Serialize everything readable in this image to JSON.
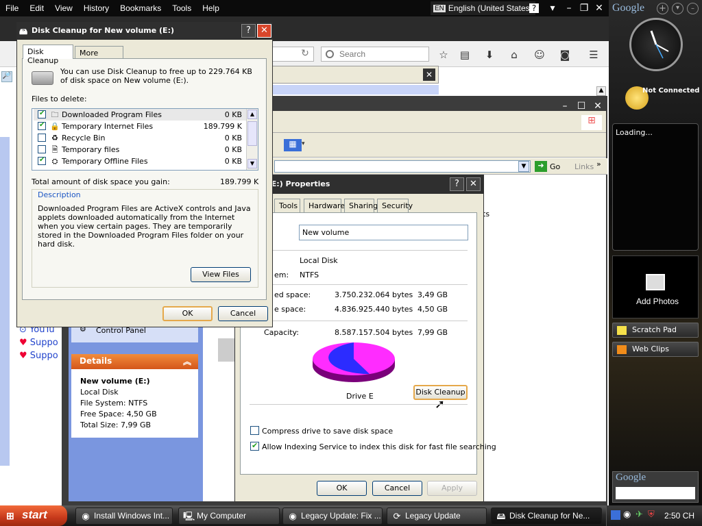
{
  "firefox": {
    "menu": [
      "File",
      "Edit",
      "View",
      "History",
      "Bookmarks",
      "Tools",
      "Help"
    ],
    "language": "English (United States)",
    "language_code": "EN",
    "search_placeholder": "Search"
  },
  "explorer": {
    "go_label": "Go",
    "links_label": "Links",
    "left_text": [
      "YouTu",
      "Suppo",
      "Suppo"
    ],
    "control_panel": "Control Panel",
    "details": {
      "title": "Details",
      "name": "New volume (E:)",
      "type": "Local Disk",
      "file_system": "File System: NTFS",
      "free_space": "Free Space: 4,50 GB",
      "total_size": "Total Size: 7,99 GB"
    },
    "fragment_text": "ts"
  },
  "properties": {
    "title": "me (E:) Properties",
    "tabs": [
      "Tools",
      "Hardware",
      "Sharing",
      "Security"
    ],
    "volume_name": "New volume",
    "type_value": "Local Disk",
    "fs_label": "em:",
    "fs_value": "NTFS",
    "used_label": "ed space:",
    "used_bytes": "3.750.232.064 bytes",
    "used_gb": "3,49 GB",
    "free_label": "e space:",
    "free_bytes": "4.836.925.440 bytes",
    "free_gb": "4,50 GB",
    "capacity_label": "Capacity:",
    "capacity_bytes": "8.587.157.504 bytes",
    "capacity_gb": "7,99 GB",
    "drive_label": "Drive E",
    "used_fraction": 0.437,
    "disk_cleanup_button": "Disk Cleanup",
    "compress_label": "Compress drive to save disk space",
    "compress_checked": false,
    "index_label": "Allow Indexing Service to index this disk for fast file searching",
    "index_checked": true,
    "ok": "OK",
    "cancel": "Cancel",
    "apply": "Apply",
    "colors": {
      "used": "#2c2cff",
      "free": "#ff2cff"
    }
  },
  "disk_cleanup": {
    "title": "Disk Cleanup for New volume (E:)",
    "tabs": [
      "Disk Cleanup",
      "More Options"
    ],
    "intro": "You can use Disk Cleanup to free up to 229.764 KB of disk space on New volume (E:).",
    "files_to_delete": "Files to delete:",
    "items": [
      {
        "label": "Downloaded Program Files",
        "size": "0 KB",
        "checked": true,
        "icon": "folder-icon"
      },
      {
        "label": "Temporary Internet Files",
        "size": "189.799 K",
        "checked": true,
        "icon": "lock-icon"
      },
      {
        "label": "Recycle Bin",
        "size": "0 KB",
        "checked": false,
        "icon": "recycle-bin-icon"
      },
      {
        "label": "Temporary files",
        "size": "0 KB",
        "checked": false,
        "icon": "file-icon"
      },
      {
        "label": "Temporary Offline Files",
        "size": "0 KB",
        "checked": true,
        "icon": "offline-files-icon"
      }
    ],
    "total_label": "Total amount of disk space you gain:",
    "total_value": "189.799 K",
    "description_title": "Description",
    "description": "Downloaded Program Files are ActiveX controls and Java applets downloaded automatically from the Internet when you view certain pages. They are temporarily stored in the Downloaded Program Files folder on your hard disk.",
    "view_files": "View Files",
    "ok": "OK",
    "cancel": "Cancel"
  },
  "sidebar": {
    "logo": "Google",
    "status": "Not Connected",
    "feed_loading": "Loading...",
    "add_photos": "Add Photos",
    "scratch_pad": "Scratch Pad",
    "web_clips": "Web Clips",
    "search_logo": "Google"
  },
  "taskbar": {
    "start": "start",
    "tasks": [
      {
        "label": "Install Windows Int...",
        "icon": "firefox-icon"
      },
      {
        "label": "My Computer",
        "icon": "computer-icon"
      },
      {
        "label": "Legacy Update: Fix ...",
        "icon": "firefox-icon"
      },
      {
        "label": "Legacy Update",
        "icon": "windows-update-icon"
      },
      {
        "label": "Disk Cleanup for Ne...",
        "icon": "disk-cleanup-icon"
      }
    ],
    "clock": "2:50 CH"
  }
}
